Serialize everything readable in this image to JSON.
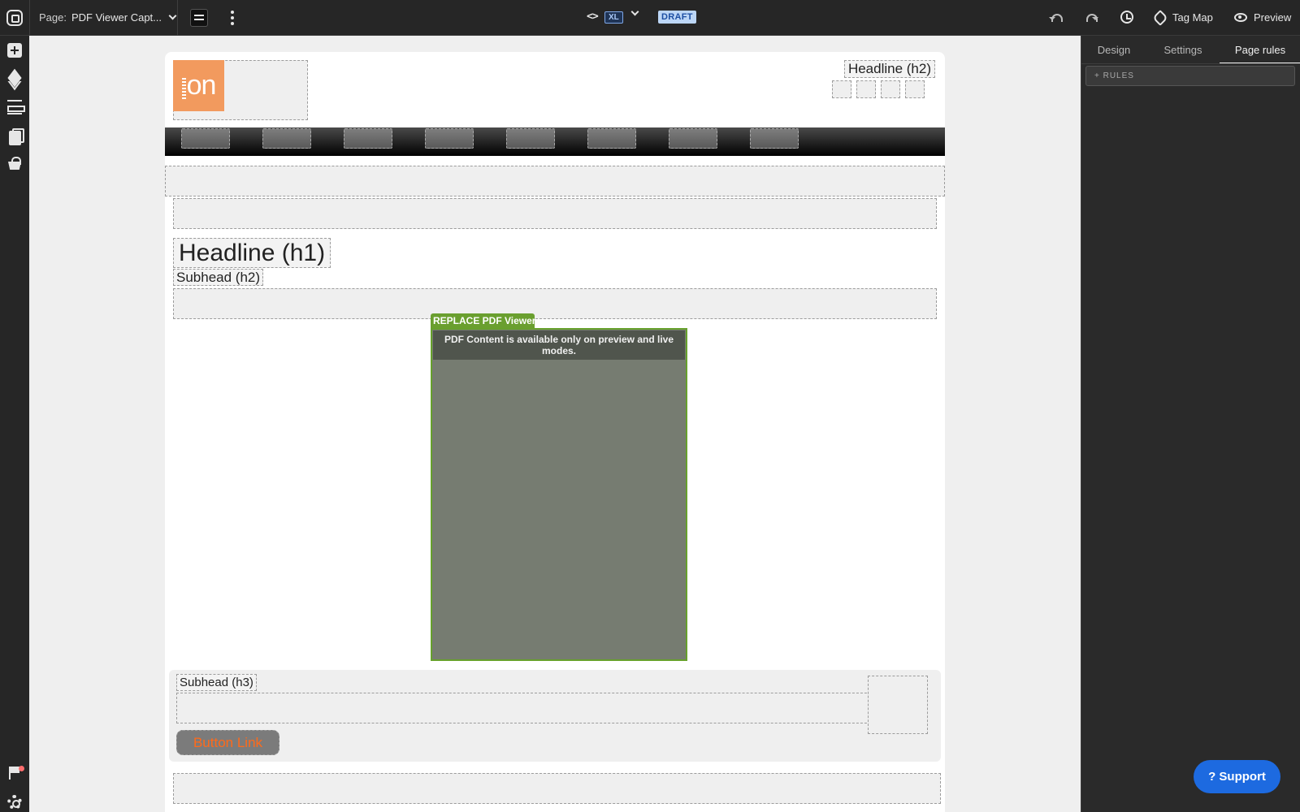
{
  "topbar": {
    "page_label": "Page:",
    "page_name": "PDF Viewer Capt...",
    "breakpoint": "XL",
    "status": "DRAFT",
    "tag_map": "Tag Map",
    "preview": "Preview"
  },
  "canvas": {
    "header_headline": "Headline (h2)",
    "logo_text": "on",
    "headline_h1": "Headline (h1)",
    "subhead_h2": "Subhead (h2)",
    "pdf_tag": "REPLACE PDF Viewer",
    "pdf_message": "PDF Content is available only on preview and live modes.",
    "subhead_h3": "Subhead (h3)",
    "button_link": "Button Link"
  },
  "panel": {
    "tabs": [
      "Design",
      "Settings",
      "Page rules"
    ],
    "active_tab": "Page rules",
    "rules_button": "+ RULES"
  },
  "support": "? Support",
  "colors": {
    "accent": "#1d6ae0",
    "pdf_tag": "#6a9f2f",
    "logo": "#f29a5e",
    "button_text": "#ff6a1a"
  }
}
